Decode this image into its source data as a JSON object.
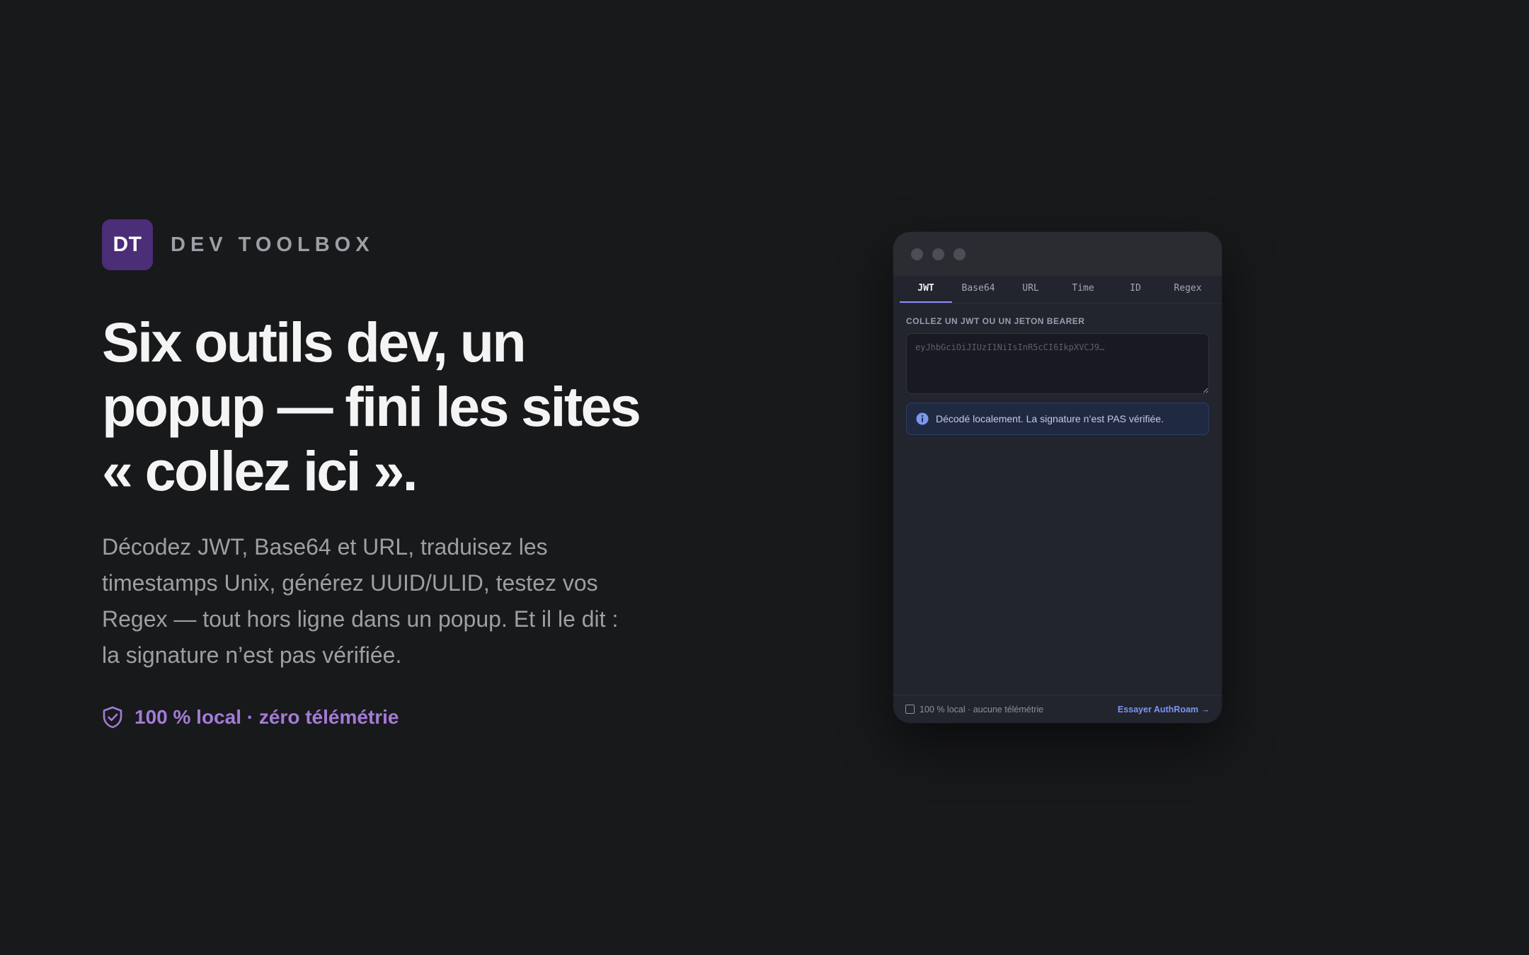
{
  "brand": {
    "logo_text": "DT",
    "name": "DEV TOOLBOX"
  },
  "hero": {
    "headline": "Six outils dev, un popup — fini les sites « collez ici ».",
    "subtitle": "Décodez JWT, Base64 et URL, traduisez les timestamps Unix, générez UUID/ULID, testez vos Regex — tout hors ligne dans un popup. Et il le dit : la signature n’est pas vérifiée.",
    "badge_icon": "shield-check-icon",
    "badge_text": "100 % local · zéro télémétrie"
  },
  "popup": {
    "tabs": [
      {
        "label": "JWT",
        "active": true
      },
      {
        "label": "Base64",
        "active": false
      },
      {
        "label": "URL",
        "active": false
      },
      {
        "label": "Time",
        "active": false
      },
      {
        "label": "ID",
        "active": false
      },
      {
        "label": "Regex",
        "active": false
      }
    ],
    "input_label": "COLLEZ UN JWT OU UN JETON BEARER",
    "input_placeholder": "eyJhbGciOiJIUzI1NiIsInR5cCI6IkpXVCJ9…",
    "input_value": "",
    "notice_icon": "info-icon",
    "notice_text": "Décodé localement. La signature n’est PAS vérifiée.",
    "footer": {
      "checkbox_label": "100 % local · aucune télémétrie",
      "link_label": "Essayer AuthRoam →"
    }
  },
  "colors": {
    "background": "#18191b",
    "brand_purple": "#4b2d78",
    "accent_purple": "#a37bd6",
    "popup_accent": "#8c8cff",
    "link_blue": "#7d95f0"
  }
}
